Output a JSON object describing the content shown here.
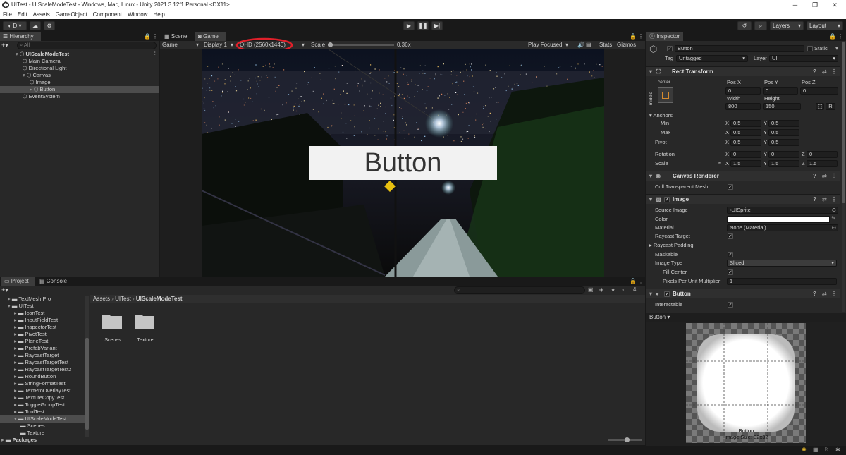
{
  "window": {
    "title": "UITest - UIScaleModeTest - Windows, Mac, Linux - Unity 2021.3.12f1 Personal <DX11>",
    "min": "─",
    "max": "❐",
    "close": "✕"
  },
  "menu": [
    "File",
    "Edit",
    "Assets",
    "GameObject",
    "Component",
    "Window",
    "Help"
  ],
  "toolbar": {
    "account": "D",
    "layers": "Layers",
    "layout": "Layout"
  },
  "hierarchy": {
    "tab": "Hierarchy",
    "search_placeholder": "All",
    "items": [
      {
        "label": "UIScaleModeTest",
        "indent": 0
      },
      {
        "label": "Main Camera",
        "indent": 1
      },
      {
        "label": "Directional Light",
        "indent": 1
      },
      {
        "label": "Canvas",
        "indent": 1
      },
      {
        "label": "Image",
        "indent": 2
      },
      {
        "label": "Button",
        "indent": 2
      },
      {
        "label": "EventSystem",
        "indent": 1
      }
    ]
  },
  "game": {
    "tab_scene": "Scene",
    "tab_game": "Game",
    "mode": "Game",
    "display": "Display 1",
    "resolution": "QHD (2560x1440)",
    "scale_label": "Scale",
    "scale_value": "0.36x",
    "play_focused": "Play Focused",
    "stats": "Stats",
    "gizmos": "Gizmos",
    "button_text": "Button",
    "accent_ellipse": "#e0202a"
  },
  "project": {
    "tab_project": "Project",
    "tab_console": "Console",
    "breadcrumb": [
      "Assets",
      "UITest",
      "UIScaleModeTest"
    ],
    "count": "4",
    "tree": [
      {
        "label": "TextMesh Pro",
        "indent": 1
      },
      {
        "label": "UITest",
        "indent": 1
      },
      {
        "label": "IconTest",
        "indent": 2
      },
      {
        "label": "InputFieldTest",
        "indent": 2
      },
      {
        "label": "InspectorTest",
        "indent": 2
      },
      {
        "label": "PivotTest",
        "indent": 2
      },
      {
        "label": "PlaneTest",
        "indent": 2
      },
      {
        "label": "PrefabVariant",
        "indent": 2
      },
      {
        "label": "RaycastTarget",
        "indent": 2
      },
      {
        "label": "RaycastTargetTest",
        "indent": 2
      },
      {
        "label": "RaycastTargetTest2",
        "indent": 2
      },
      {
        "label": "RoundButton",
        "indent": 2
      },
      {
        "label": "StringFormatTest",
        "indent": 2
      },
      {
        "label": "TextProOverlayTest",
        "indent": 2
      },
      {
        "label": "TextureCopyTest",
        "indent": 2
      },
      {
        "label": "ToggleGroupTest",
        "indent": 2
      },
      {
        "label": "ToolTest",
        "indent": 2
      },
      {
        "label": "UIScaleModeTest",
        "indent": 2
      },
      {
        "label": "Scenes",
        "indent": 3
      },
      {
        "label": "Texture",
        "indent": 3
      },
      {
        "label": "Packages",
        "indent": 0
      }
    ],
    "folders": [
      "Scenes",
      "Texture"
    ]
  },
  "inspector": {
    "tab": "Inspector",
    "name": "Button",
    "static": "Static",
    "tag_label": "Tag",
    "tag_value": "Untagged",
    "layer_label": "Layer",
    "layer_value": "UI",
    "rect": {
      "title": "Rect Transform",
      "anchor_h": "center",
      "anchor_v": "middle",
      "posx_label": "Pos X",
      "posy_label": "Pos Y",
      "posz_label": "Pos Z",
      "posx": "0",
      "posy": "0",
      "posz": "0",
      "width_label": "Width",
      "height_label": "Height",
      "width": "800",
      "height": "150",
      "r_btn": "R",
      "anchors": "Anchors",
      "min": "Min",
      "max": "Max",
      "pivot": "Pivot",
      "rotation": "Rotation",
      "scale": "Scale",
      "x": "X",
      "y": "Y",
      "z": "Z",
      "min_x": "0.5",
      "min_y": "0.5",
      "max_x": "0.5",
      "max_y": "0.5",
      "pivot_x": "0.5",
      "pivot_y": "0.5",
      "rot_x": "0",
      "rot_y": "0",
      "rot_z": "0",
      "scale_x": "1.5",
      "scale_y": "1.5",
      "scale_z": "1.5"
    },
    "canvas_renderer": {
      "title": "Canvas Renderer",
      "cull": "Cull Transparent Mesh"
    },
    "image": {
      "title": "Image",
      "source_label": "Source Image",
      "source_value": "UISprite",
      "color_label": "Color",
      "material_label": "Material",
      "material_value": "None (Material)",
      "raycast_target": "Raycast Target",
      "raycast_padding": "Raycast Padding",
      "maskable": "Maskable",
      "image_type_label": "Image Type",
      "image_type_value": "Sliced",
      "fill_center": "Fill Center",
      "ppu_label": "Pixels Per Unit Multiplier",
      "ppu_value": "1"
    },
    "button": {
      "title": "Button",
      "interactable": "Interactable"
    },
    "preview": {
      "header": "Button",
      "name": "Button",
      "size": "Image Size: 32x32"
    }
  }
}
